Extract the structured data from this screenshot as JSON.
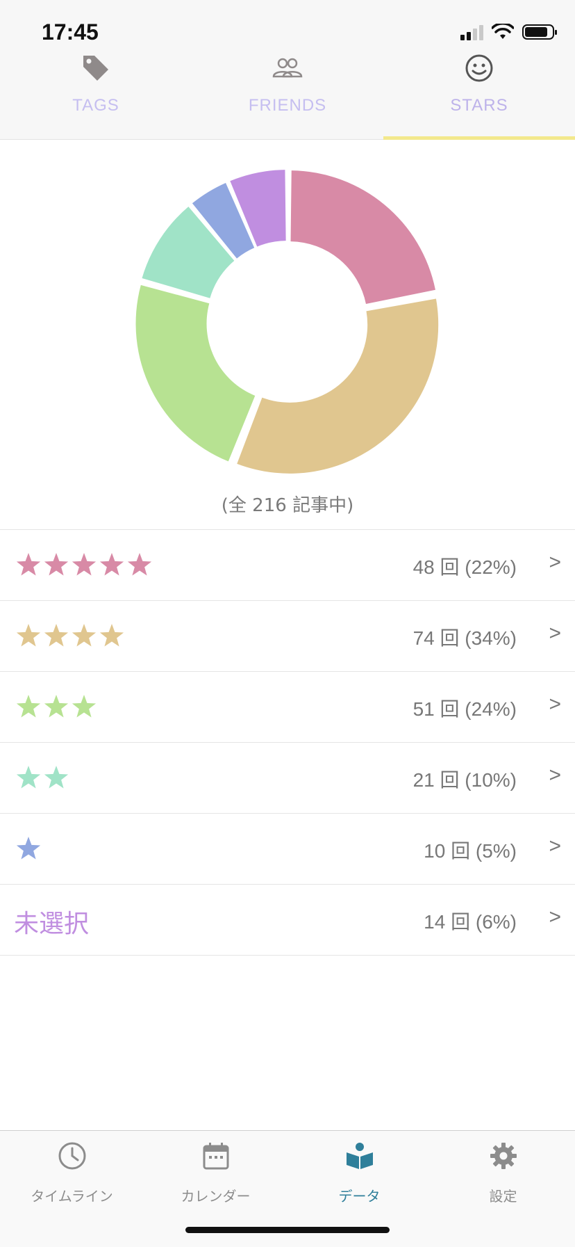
{
  "status_bar": {
    "time": "17:45"
  },
  "tabs": [
    {
      "label": "TAGS",
      "icon": "tag-icon",
      "active": false
    },
    {
      "label": "FRIENDS",
      "icon": "friends-icon",
      "active": false
    },
    {
      "label": "STARS",
      "icon": "smiley-icon",
      "active": true
    }
  ],
  "colors": {
    "five_star": "#d88aa6",
    "four_star": "#e0c68f",
    "three_star": "#b7e292",
    "two_star": "#a0e3c7",
    "one_star": "#90a7e0",
    "unselected": "#c08ee0",
    "tab_underline": "#f3e98c",
    "active_nav": "#2f7f9a"
  },
  "chart_data": {
    "type": "pie",
    "categories": [
      "5 stars",
      "4 stars",
      "3 stars",
      "2 stars",
      "1 star",
      "未選択"
    ],
    "values": [
      48,
      74,
      51,
      21,
      10,
      14
    ],
    "colors": [
      "#d88aa6",
      "#e0c68f",
      "#b7e292",
      "#a0e3c7",
      "#90a7e0",
      "#c08ee0"
    ],
    "donut": true
  },
  "caption": "(全 216 記事中)",
  "rows": [
    {
      "stars": 5,
      "value_text": "48 回 (22%)",
      "chevron": ">"
    },
    {
      "stars": 4,
      "value_text": "74 回 (34%)",
      "chevron": ">"
    },
    {
      "stars": 3,
      "value_text": "51 回 (24%)",
      "chevron": ">"
    },
    {
      "stars": 2,
      "value_text": "21 回 (10%)",
      "chevron": ">"
    },
    {
      "stars": 1,
      "value_text": "10 回 (5%)",
      "chevron": ">"
    },
    {
      "label": "未選択",
      "value_text": "14 回 (6%)",
      "chevron": ">"
    }
  ],
  "bottom_nav": [
    {
      "label": "タイムライン",
      "icon": "clock-icon",
      "active": false
    },
    {
      "label": "カレンダー",
      "icon": "calendar-icon",
      "active": false
    },
    {
      "label": "データ",
      "icon": "book-reader-icon",
      "active": true
    },
    {
      "label": "設定",
      "icon": "gear-icon",
      "active": false
    }
  ]
}
